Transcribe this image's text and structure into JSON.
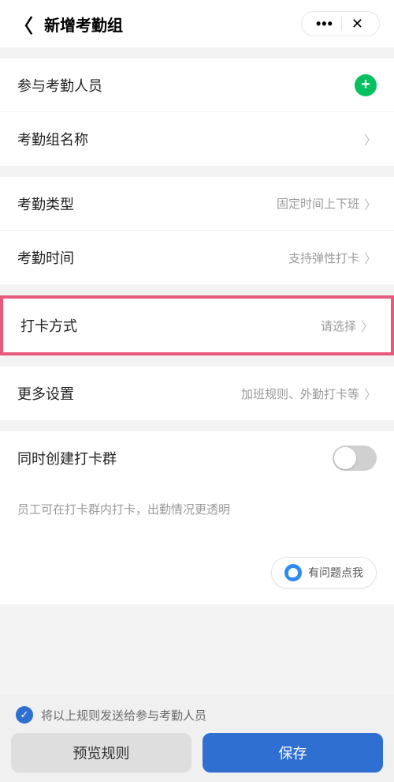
{
  "header": {
    "title": "新增考勤组"
  },
  "section1": {
    "participants_label": "参与考勤人员",
    "group_name_label": "考勤组名称"
  },
  "section2": {
    "type_label": "考勤类型",
    "type_value": "固定时间上下班",
    "time_label": "考勤时间",
    "time_value": "支持弹性打卡"
  },
  "section3": {
    "method_label": "打卡方式",
    "method_value": "请选择"
  },
  "section4": {
    "more_label": "更多设置",
    "more_value": "加班规则、外勤打卡等"
  },
  "section5": {
    "create_group_label": "同时创建打卡群",
    "hint": "员工可在打卡群内打卡，出勤情况更透明"
  },
  "help": {
    "text": "有问题点我"
  },
  "footer": {
    "send_text": "将以上规则发送给参与考勤人员",
    "preview": "预览规则",
    "save": "保存"
  }
}
